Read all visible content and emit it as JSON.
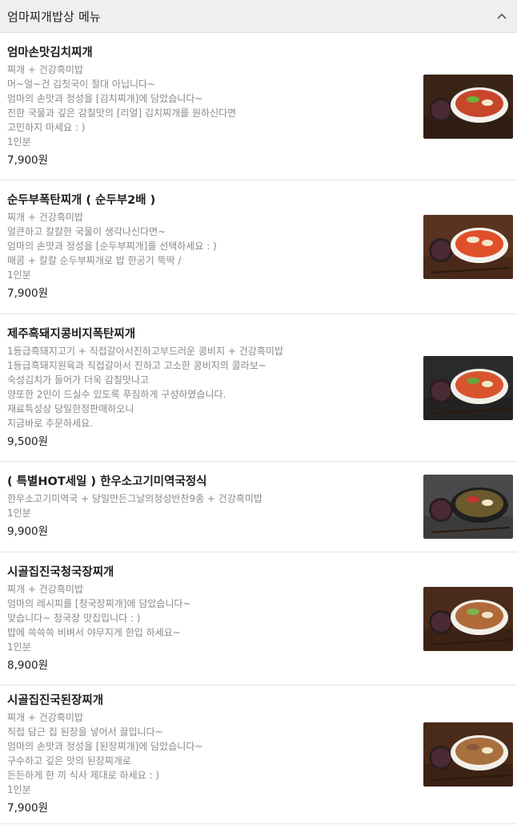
{
  "header": {
    "title": "엄마찌개밥상 메뉴"
  },
  "items": [
    {
      "name": "엄마손맛김치찌개",
      "lines": [
        "찌개 + 건강흑미밥",
        "머~얼~건 김칫국이 절대 아닙니다~",
        "엄마의 손맛과 정성을 [김치찌개]에 담았습니다~",
        "진한 국물과 깊은 감칠맛의 [리얼] 김치찌개를 원하신다면",
        "고민하지 마세요 : )",
        "1인분"
      ],
      "price": "7,900원",
      "photo": {
        "bg": "#3a2418",
        "bowl": "#f4f1ec",
        "soup": "#c8462a",
        "garnish": "#6fae3a"
      }
    },
    {
      "name": "순두부폭탄찌개 ( 순두부2배 )",
      "lines": [
        "찌개 + 건강흑미밥",
        "얼큰하고 칼칼한 국물이 생각나신다면~",
        "엄마의 손맛과 정성을 [순두부찌개]를 선택하세요 : )",
        "매콤 + 칼칼 순두부찌개로 밥 한공기 뚝딱 /",
        "1인분"
      ],
      "price": "7,900원",
      "photo": {
        "bg": "#5a3320",
        "bowl": "#f6f3ee",
        "soup": "#e0502a",
        "garnish": "#f3e6c8"
      }
    },
    {
      "name": "제주흑돼지콩비지폭탄찌개",
      "lines": [
        "1등급흑돼지고기 + 직접갈아서진하고부드러운 콩비지 + 건강흑미밥",
        "1등급흑돼지원육과 직접갈아서 진하고 고소한 콩비지의 콜라보~",
        "숙성김치가 들어가 더욱 감칠맛나고",
        "양또한 2인이 드실수 있도록 푸짐하게 구성하였습니다.",
        "재료특성상 당일한정판매하오니",
        "지금바로 주문하세요."
      ],
      "price": "9,500원",
      "photo": {
        "bg": "#2a2a2a",
        "bowl": "#f2efe9",
        "soup": "#d8542e",
        "garnish": "#6aa33a"
      }
    },
    {
      "name": "( 특별HOT세일 ) 한우소고기미역국정식",
      "lines": [
        "한우소고기미역국 + 당일만든그날의정성반찬9종 + 건강흑미밥",
        "1인분"
      ],
      "price": "9,900원",
      "photo": {
        "bg": "#4a4a4a",
        "bowl": "#1f1f1f",
        "soup": "#6b5a2e",
        "garnish": "#c0392b"
      }
    },
    {
      "name": "시골집진국청국장찌개",
      "lines": [
        "찌개 + 건강흑미밥",
        "엄마의 레시피를 [청국장찌개]에 담았습니다~",
        "맞습니다~ 청국장 맛집입니다 : )",
        "밥에 쓱쓱쓱 비벼서 야무지게 한입 하세요~",
        "1인분"
      ],
      "price": "8,900원",
      "photo": {
        "bg": "#4a2a1a",
        "bowl": "#f3f0ea",
        "soup": "#b06a3a",
        "garnish": "#7db34a"
      }
    },
    {
      "name": "시골집진국된장찌개",
      "lines": [
        "찌개 + 건강흑미밥",
        "직접 담근 집 된장을 넣어서 끓입니다~",
        "엄마의 손맛과 정성을 [된장찌개]에 담았습니다~",
        "구수하고 깊은 맛의 된장찌개로",
        "든든하게 한 끼 식사 제대로 하세요 : )",
        "1인분"
      ],
      "price": "7,900원",
      "photo": {
        "bg": "#4a2a1a",
        "bowl": "#f3f0ea",
        "soup": "#a8703e",
        "garnish": "#8a5a3a"
      }
    }
  ]
}
